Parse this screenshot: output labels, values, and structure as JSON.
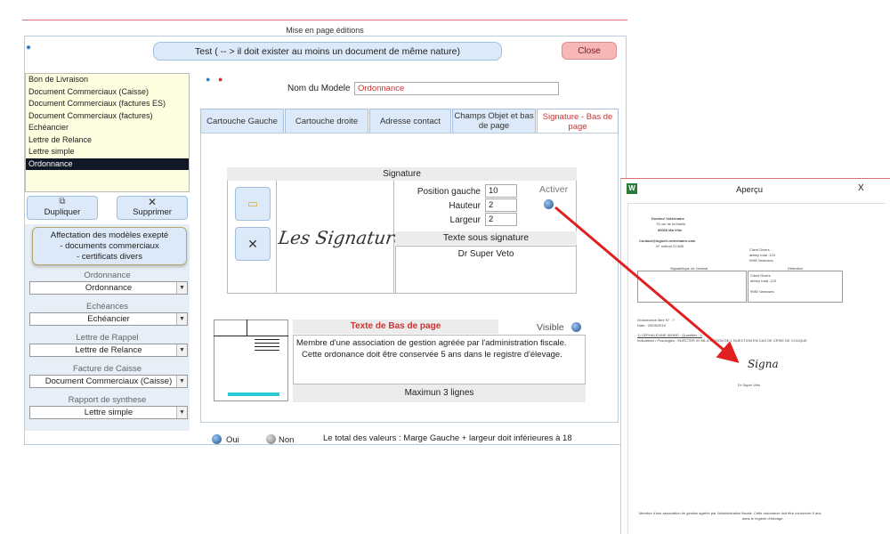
{
  "window": {
    "title": "Mise en page éditions"
  },
  "banner": {
    "text": "Test ( -- > il doit exister au moins un document de même nature)"
  },
  "close_label": "Close",
  "documents": [
    "Bon de Livraison",
    "Document Commerciaux (Caisse)",
    "Document Commerciaux (factures ES)",
    "Document Commerciaux (factures)",
    "Echéancier",
    "Lettre de Relance",
    "Lettre simple",
    "Ordonnance"
  ],
  "selected_document": "Ordonnance",
  "buttons": {
    "duplicate": "Dupliquer",
    "delete": "Supprimer"
  },
  "affectation": {
    "line1": "Affectation des modèles exepté",
    "line2": "- documents commerciaux",
    "line3": "- certificats divers"
  },
  "combos": [
    {
      "label": "Ordonnance",
      "value": "Ordonnance"
    },
    {
      "label": "Echéances",
      "value": "Echéancier"
    },
    {
      "label": "Lettre de Rappel",
      "value": "Lettre de Relance"
    },
    {
      "label": "Facture de Caisse",
      "value": "Document Commerciaux (Caisse)"
    },
    {
      "label": "Rapport de synthese",
      "value": "Lettre simple"
    }
  ],
  "model": {
    "label": "Nom du Modele",
    "value": "Ordonnance"
  },
  "tabs": [
    "Cartouche Gauche",
    "Cartouche droite",
    "Adresse contact",
    "Champs Objet et bas de page",
    "Signature - Bas de page"
  ],
  "signature": {
    "header": "Signature",
    "image_text": "Les Signatures",
    "position_label": "Position gauche",
    "position_value": "10",
    "height_label": "Hauteur",
    "height_value": "2",
    "width_label": "Largeur",
    "width_value": "2",
    "activate_label": "Activer",
    "text_under_header": "Texte sous signature",
    "text_under_value": "Dr Super Veto"
  },
  "footer": {
    "header": "Texte de Bas de page",
    "visible_label": "Visible",
    "text_line1": "Membre d'une association de gestion agréée par l'administration fiscale.",
    "text_line2": "Cette ordonance doit être conservée 5 ans dans le registre d'élevage.",
    "max_label": "Maximun 3 lignes"
  },
  "legend": {
    "yes": "Oui",
    "no": "Non",
    "note": "Le total des valeurs :  Marge Gauche + largeur doit inférieures à 18"
  },
  "preview": {
    "title": "Aperçu",
    "close": "X",
    "app_icon": "W",
    "doc_title": "Docteur Vétérinaire",
    "doc_address": "74 rue de la Mairie",
    "doc_city": "99000  Ma Ville",
    "doc_contact": "Contact@logiciel-veterinaire.com",
    "doc_order": "N° ordinal 21 685",
    "client1": "Client Divers",
    "client2": "abbey road ,123",
    "client3": "9980  Vareuses",
    "col_left": "Signalétique de l'animal",
    "col_right": "Détenteur",
    "box1": "Client Divers",
    "box2": "abbey road ,123",
    "box3": "9980 Vareuses",
    "ord_no": "Ordonnance libre N° : 7",
    "ord_date": "Date : 29/05/2019",
    "ord_line": "1) CEPHALEXINE 500MG : Quantités : 1",
    "ord_indic": "Indications / Posologies : INJECTER 20 ML A RAISON DE 1 INJECTION EN CAS DE CRISE DE COLIQUE",
    "sig_preview": "Signa",
    "sig_name": "Dr Super Veto",
    "footer_text": "Membre d'une association de gestion agréée par l'administration fiscale. Cette ordonance doit être conservée 5 ans",
    "footer_text2": "dans le registre d'élevage."
  },
  "colors": {
    "accent": "#dbe9f8",
    "selected": "#101828",
    "arrow": "#e02020",
    "active_tab_text": "#cc3333"
  }
}
